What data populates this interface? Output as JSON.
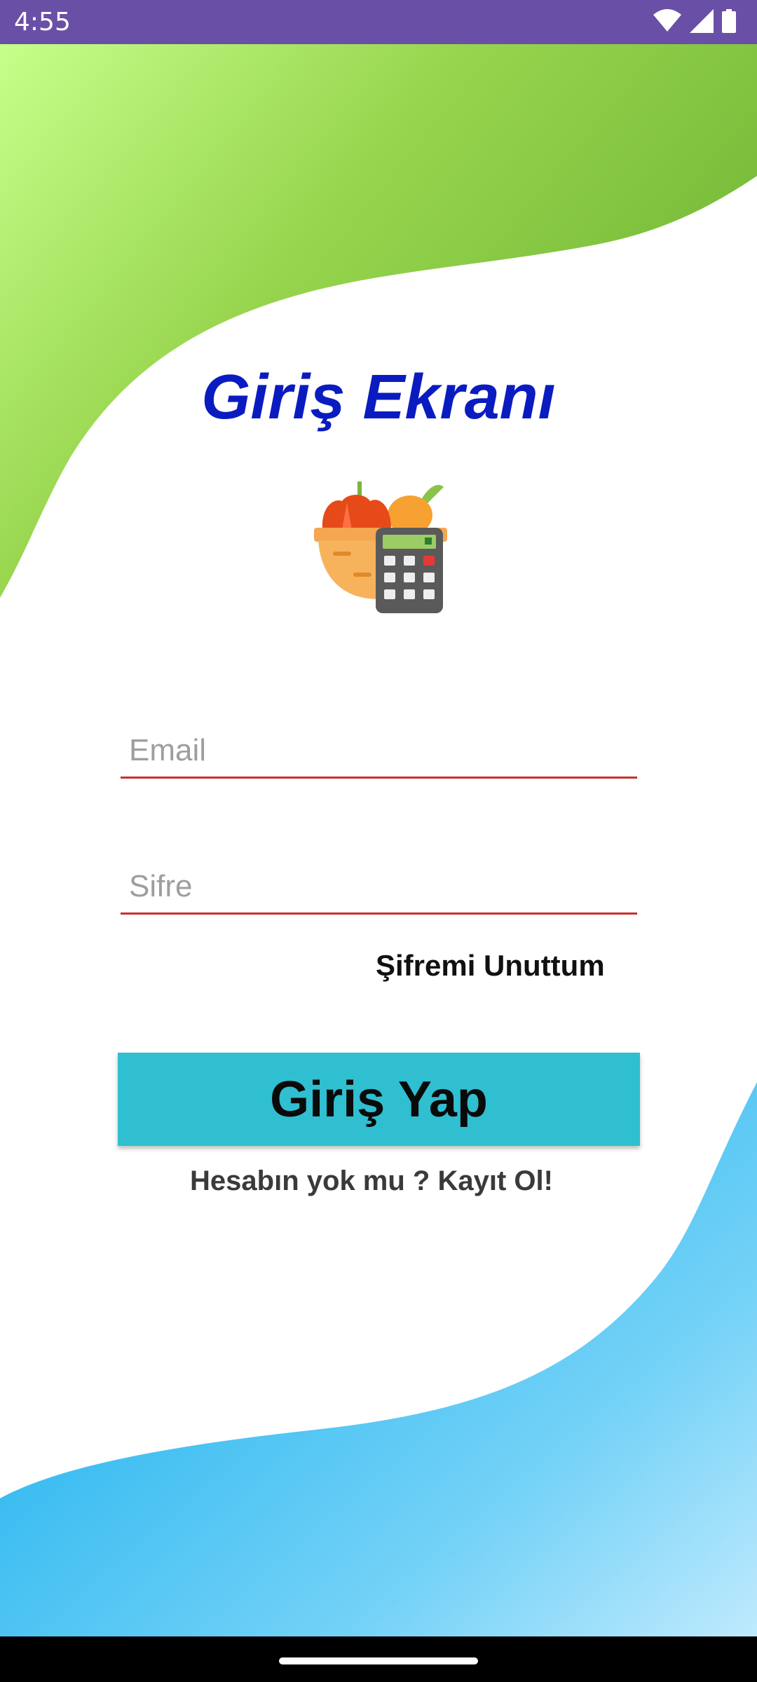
{
  "status_bar": {
    "time": "4:55"
  },
  "login": {
    "title": "Giriş Ekranı",
    "email_placeholder": "Email",
    "password_placeholder": "Sifre",
    "forgot_password": "Şifremi Unuttum",
    "login_button": "Giriş Yap",
    "signup_link": "Hesabın yok mu ? Kayıt Ol!"
  },
  "icons": {
    "logo": "vegetable-basket-calculator-icon",
    "status": [
      "wifi-icon",
      "cellular-signal-icon",
      "battery-icon"
    ]
  },
  "colors": {
    "status_bar": "#6a4fa6",
    "title": "#0a1cc0",
    "button": "#2fbfd0",
    "field_underline": "#c9302c",
    "top_wave": "#7cbd3c",
    "bottom_wave": "#3fc0f2"
  }
}
